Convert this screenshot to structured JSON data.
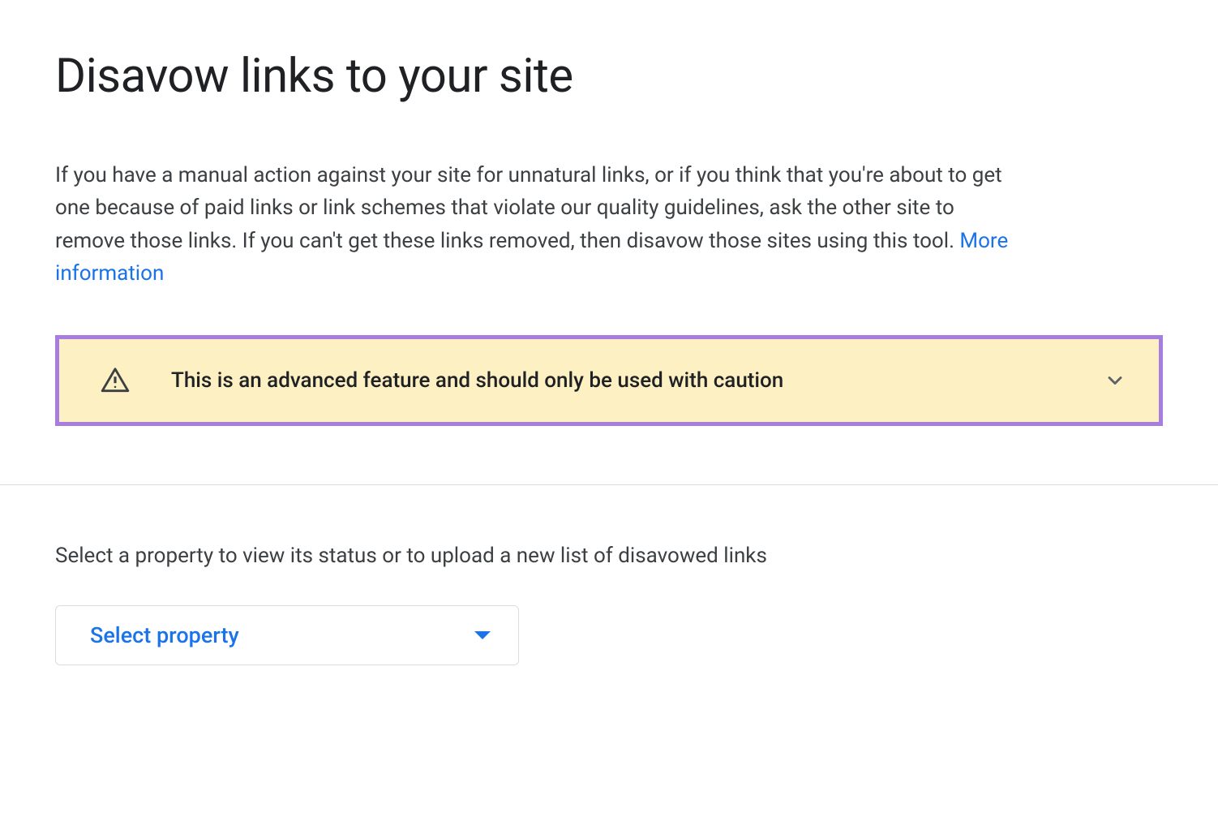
{
  "page": {
    "title": "Disavow links to your site",
    "description": "If you have a manual action against your site for unnatural links, or if you think that you're about to get one because of paid links or link schemes that violate our quality guidelines, ask the other site to remove those links. If you can't get these links removed, then disavow those sites using this tool. ",
    "more_info_label": "More information"
  },
  "warning": {
    "text": "This is an advanced feature and should only be used with caution"
  },
  "select": {
    "label": "Select a property to view its status or to upload a new list of disavowed links",
    "button_text": "Select property"
  }
}
